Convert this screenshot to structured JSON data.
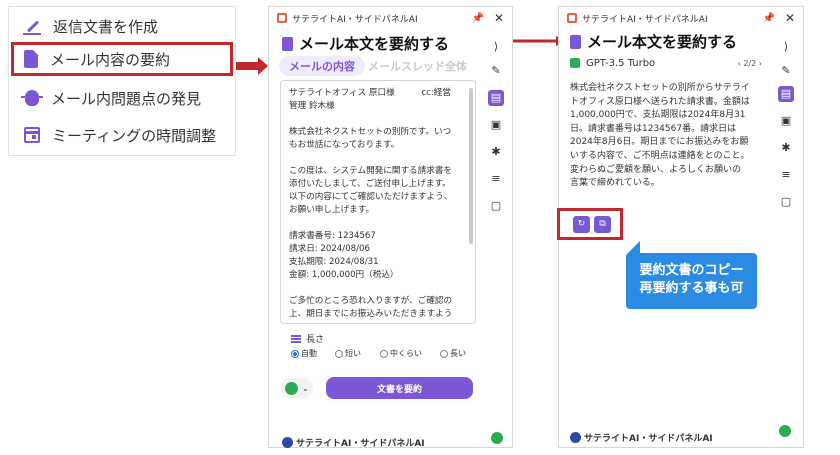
{
  "menu": {
    "items": [
      {
        "label": "返信文書を作成",
        "icon": "pen-icon"
      },
      {
        "label": "メール内容の要約",
        "icon": "document-icon"
      },
      {
        "label": "メール内問題点の発見",
        "icon": "bug-icon"
      },
      {
        "label": "ミーティングの時間調整",
        "icon": "calendar-icon"
      }
    ]
  },
  "panel1": {
    "window_title": "サテライトAI・サイドパネルAI",
    "heading": "メール本文を要約する",
    "tabs": [
      "メールの内容",
      "メールスレッド全体"
    ],
    "email_lines": [
      "サテライトオフィス 原口様",
      "管理 鈴木様",
      "",
      "株式会社ネクストセットの別所です。いつ",
      "もお世話になっております。",
      "",
      "この度は、システム開発に関する請求書を",
      "添付いたしまして、ご送付申し上げます。",
      "以下の内容にてご確認いただけますよう、",
      "お願い申し上げます。",
      "",
      "請求書番号: 1234567",
      "請求日: 2024/08/06",
      "支払期限: 2024/08/31",
      "金額: 1,000,000円（税込）",
      "",
      "ご多忙のところ恐れ入りますが、ご確認の",
      "上、期日までにお振込みいただきますよう"
    ],
    "email_cc": "cc:経営",
    "length_label": "長さ",
    "length_options": [
      "自動",
      "短い",
      "中くらい",
      "長い"
    ],
    "length_selected": "自動",
    "summarize_button": "文書を要約",
    "footer": "サテライトAI・サイドパネルAI"
  },
  "panel2": {
    "window_title": "サテライトAI・サイドパネルAI",
    "heading": "メール本文を要約する",
    "model": "GPT-3.5 Turbo",
    "pager": "‹ 2/2 ›",
    "summary_lines": [
      "株式会社ネクストセットの別所からサテライ",
      "トオフィス原口様へ送られた請求書。金額は",
      "1,000,000円で、支払期限は2024年8月31",
      "日。請求書番号は1234567番。請求日は",
      "2024年8月6日。期日までにお振込みをお願",
      "いする内容で、ご不明点は連絡をとのこと。",
      "変わらぬご愛顧を願い、よろしくお願いの",
      "言葉で締めれている。"
    ],
    "footer": "サテライトAI・サイドパネルAI"
  },
  "callout": {
    "line1": "要約文書のコピー",
    "line2": "再要約する事も可"
  },
  "colors": {
    "accent": "#7b57d6",
    "highlight_red": "#c0282d",
    "callout_blue": "#2b8be2",
    "green": "#2eaa52"
  }
}
